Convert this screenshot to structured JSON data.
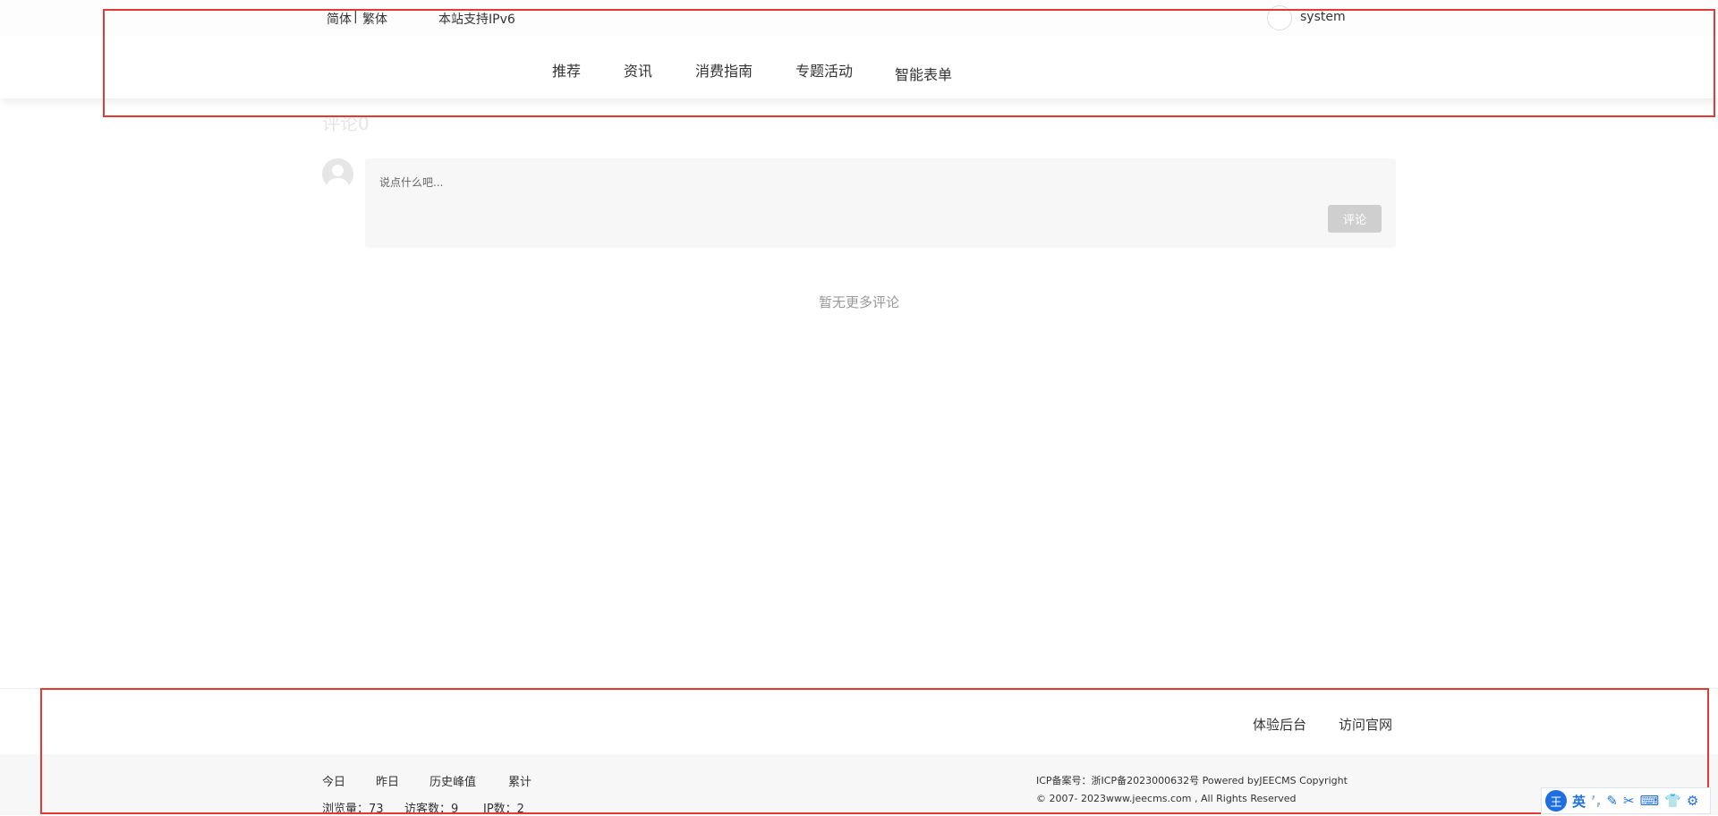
{
  "topbar": {
    "lang_simplified": "简体",
    "lang_separator": "|",
    "lang_traditional": "繁体",
    "ipv6": "本站支持IPv6",
    "username": "system"
  },
  "nav": [
    {
      "label": "推荐"
    },
    {
      "label": "资讯"
    },
    {
      "label": "消费指南"
    },
    {
      "label": "专题活动"
    },
    {
      "label": "智能表单"
    }
  ],
  "comments": {
    "title": "评论0",
    "placeholder": "说点什么吧...",
    "submit_label": "评论",
    "empty_text": "暂无更多评论"
  },
  "footer": {
    "links": [
      "体验后台",
      "访问官网"
    ],
    "stat_tabs": [
      "今日",
      "昨日",
      "历史峰值",
      "累计"
    ],
    "stats": {
      "views": "浏览量：73",
      "visitors": "访客数：9",
      "ips": "IP数：2"
    },
    "icp": "ICP备案号：浙ICP备2023000632号 Powered byJEECMS  Copyright",
    "copyright": "© 2007- 2023www.jeecms.com , All Rights Reserved"
  },
  "ime": {
    "logo": "王",
    "mode": "英",
    "punct": "’,"
  }
}
